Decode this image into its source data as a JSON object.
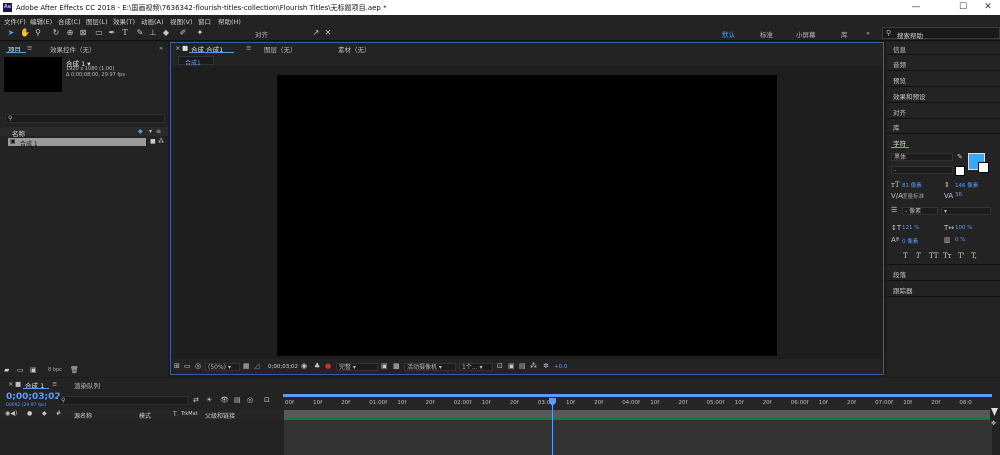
{
  "window": {
    "app_icon_text": "Ae",
    "title": "Adobe After Effects CC 2018 - E:\\国画视频\\7636342-flourish-titles-collection\\Flourish Titles\\无标题项目.aep *",
    "minimize": "—",
    "maximize": "☐",
    "close": "✕"
  },
  "menu": [
    "文件(F)",
    "编辑(E)",
    "合成(C)",
    "图层(L)",
    "效果(T)",
    "动画(A)",
    "视图(V)",
    "窗口",
    "帮助(H)"
  ],
  "toolbar": {
    "snap_label": "对齐",
    "workspaces": [
      "默认",
      "标准",
      "小屏幕",
      "库"
    ],
    "overflow": "»",
    "search_placeholder": "搜索帮助"
  },
  "project_panel": {
    "tab_project": "项目",
    "tab_effects": "效果控件（无）",
    "comp_name": "合成 1 ▾",
    "comp_size": "1920 x 1080 (1.00)",
    "comp_duration": "Δ 0;00;08;00, 29.97 fps",
    "col_name": "名称",
    "item_name": "合成 1",
    "bpc": "8 bpc"
  },
  "comp_panel": {
    "tab_comp": "合成 合成1",
    "tab_layer": "图层（无）",
    "tab_footage": "素材（无）",
    "breadcrumb": "合成1",
    "zoom": "(50%)",
    "timecode": "0;00;03;02",
    "quality": "完整",
    "camera": "活动摄像机",
    "views": "1个...",
    "exposure": "+0.0"
  },
  "right_panel": {
    "items_top": [
      "信息",
      "音频",
      "预览",
      "效果和预设",
      "对齐",
      "库"
    ],
    "char_title": "字符",
    "font": "黑体",
    "style": "-",
    "size_val": "81 像素",
    "leading_val": "146 像素",
    "kerning_label": "度量标准",
    "tracking_val": "36",
    "stroke_val": "- 像素",
    "vscale": "121 %",
    "hscale": "100 %",
    "baseline": "0 像素",
    "tsume": "0 %",
    "text_styles": [
      "T",
      "T",
      "TT",
      "Tт",
      "T'",
      "T,"
    ],
    "items_bottom": [
      "段落",
      "跟踪器"
    ]
  },
  "timeline": {
    "tab_comp": "合成 1",
    "tab_render": "渲染队列",
    "timecode": "0;00;03;02",
    "frames": "00092 (29.97 fps)",
    "col_source": "源名称",
    "col_mode": "模式",
    "col_t": "T",
    "col_trkmat": "TrkMat",
    "col_parent": "父级和链接",
    "ruler": [
      "00f",
      "10f",
      "20f",
      "01:00f",
      "10f",
      "20f",
      "02:00f",
      "10f",
      "20f",
      "03:00f",
      "10f",
      "20f",
      "04:00f",
      "10f",
      "20f",
      "05:00f",
      "10f",
      "20f",
      "06:00f",
      "10f",
      "20f",
      "07:00f",
      "10f",
      "20f",
      "08:0"
    ]
  },
  "colors": {
    "accent": "#5a9cff",
    "fill_swatch": "#33aaff",
    "work_area": "#1f7a3a"
  }
}
